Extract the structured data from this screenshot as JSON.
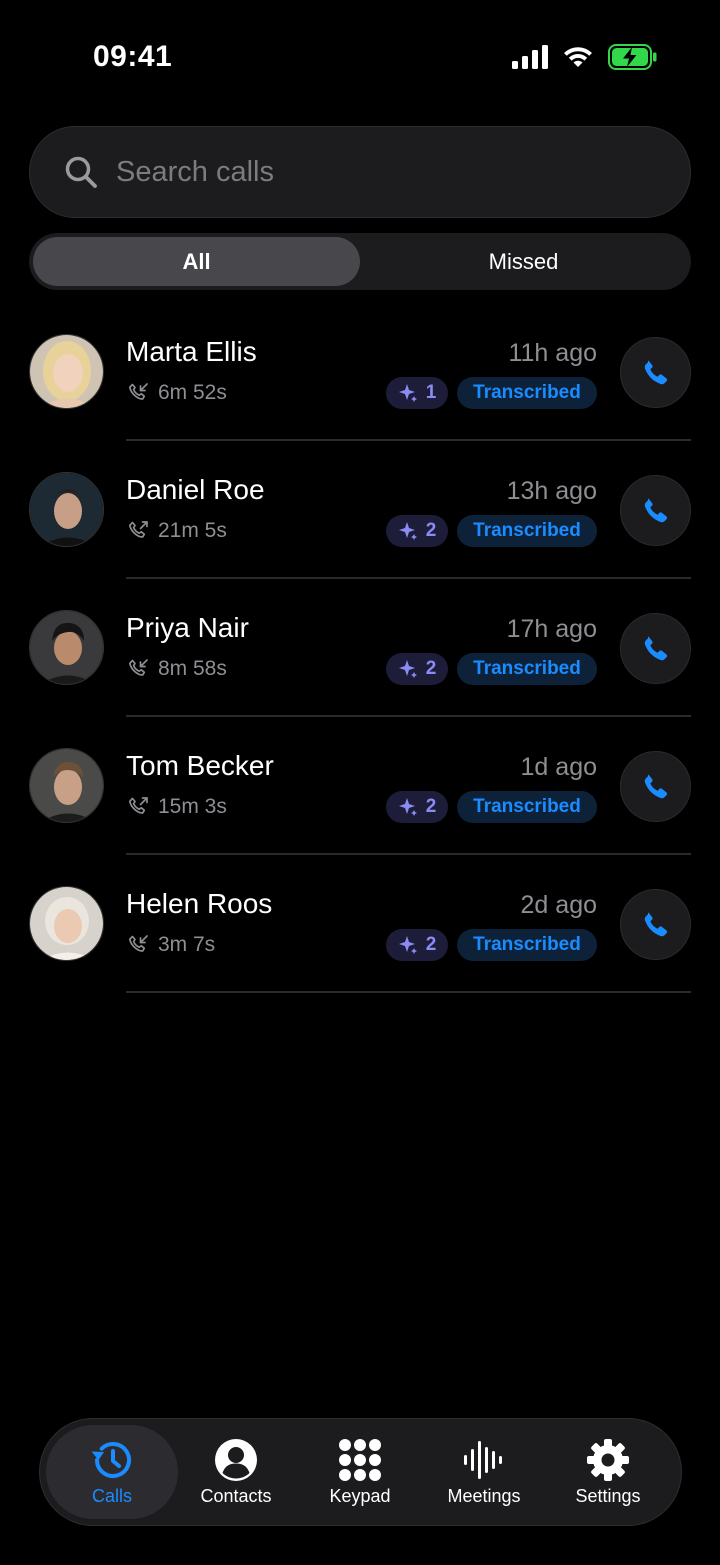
{
  "status_bar": {
    "time": "09:41"
  },
  "search": {
    "placeholder": "Search calls"
  },
  "filter": {
    "all_label": "All",
    "missed_label": "Missed"
  },
  "calls": [
    {
      "name": "Marta Ellis",
      "time_ago": "11h ago",
      "duration": "6m 52s",
      "ai_count": "1",
      "status": "Transcribed"
    },
    {
      "name": "Daniel Roe",
      "time_ago": "13h ago",
      "duration": "21m 5s",
      "ai_count": "2",
      "status": "Transcribed"
    },
    {
      "name": "Priya Nair",
      "time_ago": "17h ago",
      "duration": "8m 58s",
      "ai_count": "2",
      "status": "Transcribed"
    },
    {
      "name": "Tom Becker",
      "time_ago": "1d ago",
      "duration": "15m 3s",
      "ai_count": "2",
      "status": "Transcribed"
    },
    {
      "name": "Helen Roos",
      "time_ago": "2d ago",
      "duration": "3m 7s",
      "ai_count": "2",
      "status": "Transcribed"
    }
  ],
  "tabs": [
    {
      "label": "Calls",
      "icon": "history-clock-icon",
      "active": true
    },
    {
      "label": "Contacts",
      "icon": "person-circle-icon",
      "active": false
    },
    {
      "label": "Keypad",
      "icon": "keypad-grid-icon",
      "active": false
    },
    {
      "label": "Meetings",
      "icon": "waveform-icon",
      "active": false
    },
    {
      "label": "Settings",
      "icon": "gear-icon",
      "active": false
    }
  ],
  "colors": {
    "accent": "#1a8cff",
    "ai_purple": "#8b8bf5",
    "battery_green": "#32d74b",
    "muted_text": "#8e8e93",
    "surface": "#1c1c1e"
  }
}
